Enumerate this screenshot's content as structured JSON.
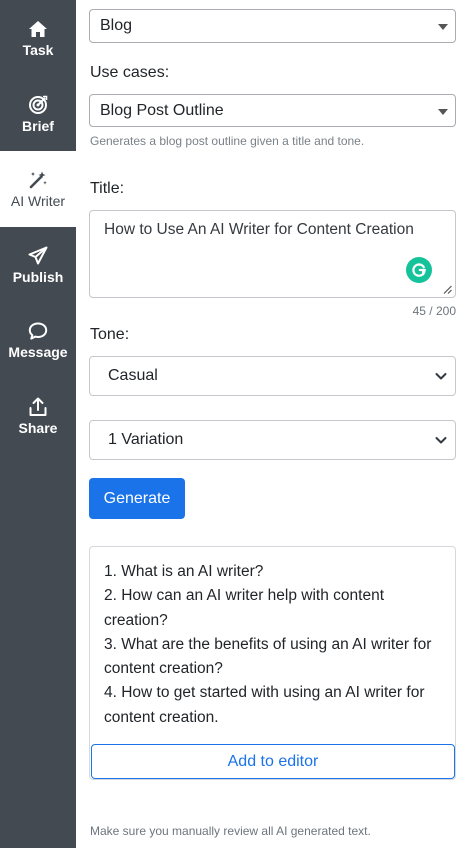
{
  "sidebar": {
    "items": [
      {
        "label": "Task",
        "icon": "home-icon"
      },
      {
        "label": "Brief",
        "icon": "target-icon"
      },
      {
        "label": "AI Writer",
        "icon": "magic-wand-icon",
        "active": true
      },
      {
        "label": "Publish",
        "icon": "send-icon"
      },
      {
        "label": "Message",
        "icon": "chat-icon"
      },
      {
        "label": "Share",
        "icon": "share-icon"
      }
    ]
  },
  "form": {
    "category_value": "Blog",
    "use_cases_label": "Use cases:",
    "use_case_value": "Blog Post Outline",
    "use_case_help": "Generates a blog post outline given a title and tone.",
    "title_label": "Title:",
    "title_value": "How to Use An AI Writer for Content Creation",
    "title_counter": "45 / 200",
    "tone_label": "Tone:",
    "tone_value": "Casual",
    "variations_value": "1 Variation",
    "generate_label": "Generate"
  },
  "output": {
    "lines": [
      "1. What is an AI writer?",
      "2. How can an AI writer help with content creation?",
      "3. What are the benefits of using an AI writer for content creation?",
      "4. How to get started with using an AI writer for content creation."
    ],
    "add_to_editor_label": "Add to editor"
  },
  "footer_note": "Make sure you manually review all AI generated text.",
  "colors": {
    "sidebar_bg": "#434a52",
    "primary": "#1a73e8",
    "grammarly": "#15c39a"
  }
}
